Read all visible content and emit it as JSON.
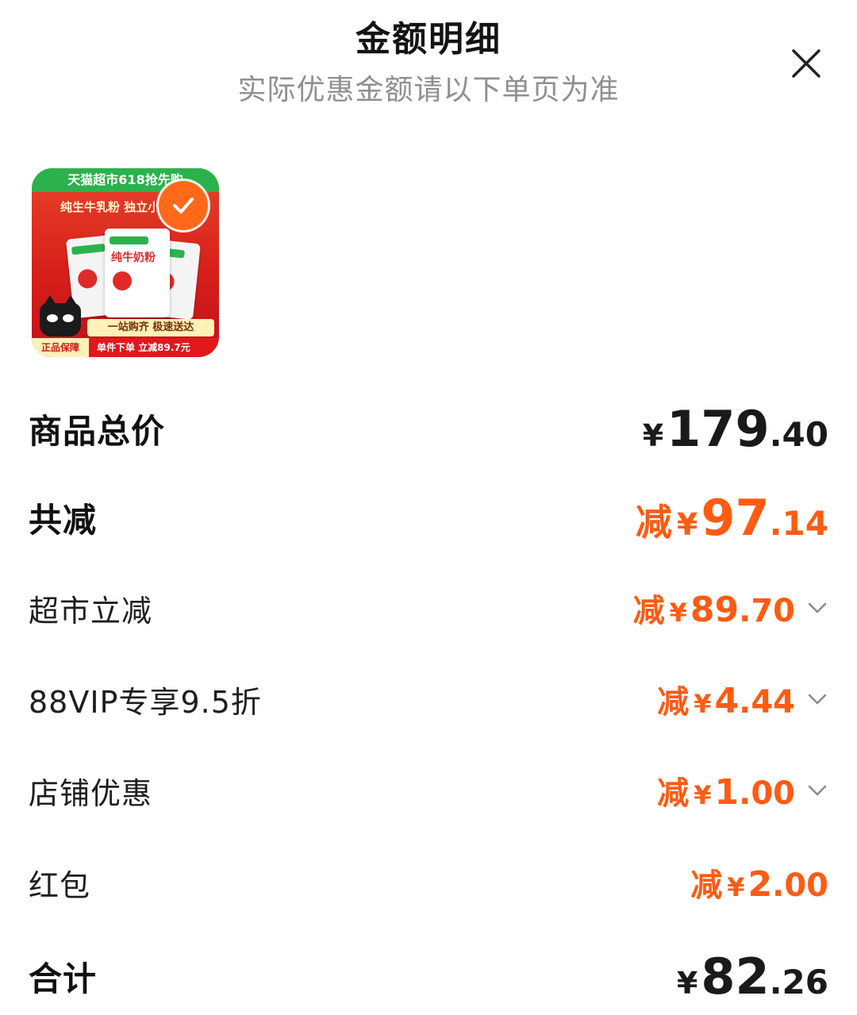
{
  "header": {
    "title": "金额明细",
    "subtitle": "实际优惠金额请以下单页为准"
  },
  "product": {
    "thumb_topbar": "天猫超市618抢先购",
    "thumb_slogan": "纯生牛乳粉 独立小袋",
    "thumb_product_name": "纯牛奶粉",
    "thumb_banner": "一站购齐 极速送达",
    "thumb_guarantee": "正品保障",
    "thumb_promo": "单件下单 立减89.7元",
    "selected": true
  },
  "summary": {
    "total_label": "商品总价",
    "total_yen": "¥",
    "total_int": "179",
    "total_dec": ".40",
    "discount_label": "共减",
    "discount_prefix": "减",
    "discount_yen": "¥",
    "discount_int": "97",
    "discount_dec": ".14",
    "final_label": "合计",
    "final_yen": "¥",
    "final_int": "82",
    "final_dec": ".26"
  },
  "discount_items": [
    {
      "label": "超市立减",
      "prefix": "减",
      "yen": "¥",
      "int": "89",
      "dec": ".70",
      "expandable": true
    },
    {
      "label": "88VIP专享9.5折",
      "prefix": "减",
      "yen": "¥",
      "int": "4",
      "dec": ".44",
      "expandable": true
    },
    {
      "label": "店铺优惠",
      "prefix": "减",
      "yen": "¥",
      "int": "1",
      "dec": ".00",
      "expandable": true
    },
    {
      "label": "红包",
      "prefix": "减",
      "yen": "¥",
      "int": "2",
      "dec": ".00",
      "expandable": false
    }
  ],
  "colors": {
    "discount_orange": "#ff5b13",
    "badge_orange": "#ff6a1a",
    "subtitle_gray": "#8f8f8f"
  },
  "icons": {
    "close": "close-icon",
    "check": "check-icon",
    "chevron": "chevron-down-icon"
  }
}
